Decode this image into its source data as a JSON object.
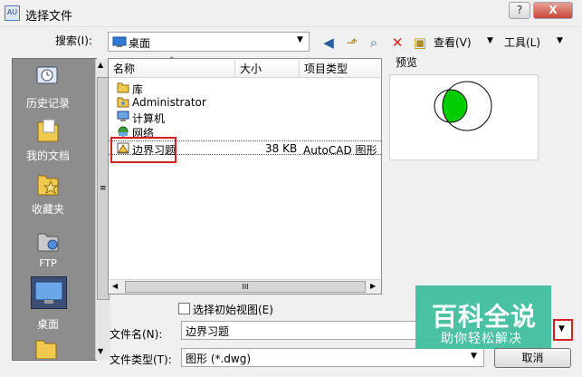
{
  "titlebar": {
    "title": "选择文件",
    "app_icon_text": "AU",
    "help_label": "?",
    "close_label": "X"
  },
  "toolbar": {
    "lookin_label": "搜索(I):",
    "location": "桌面",
    "views_label": "查看(V)",
    "tools_label": "工具(L)"
  },
  "places": [
    {
      "label": "历史记录"
    },
    {
      "label": "我的文档"
    },
    {
      "label": "收藏夹"
    },
    {
      "label": "FTP"
    },
    {
      "label": "桌面"
    }
  ],
  "file_list": {
    "columns": [
      "名称",
      "大小",
      "项目类型"
    ],
    "rows": [
      {
        "name": "库",
        "size": "",
        "type": ""
      },
      {
        "name": "Administrator",
        "size": "",
        "type": ""
      },
      {
        "name": "计算机",
        "size": "",
        "type": ""
      },
      {
        "name": "网络",
        "size": "",
        "type": ""
      },
      {
        "name": "边界习题",
        "size": "38 KB",
        "type": "AutoCAD 图形"
      }
    ],
    "selected_row": 4,
    "hscroll_label": "III"
  },
  "preview": {
    "label": "预览"
  },
  "options": {
    "initial_view_label": "选择初始视图(E)",
    "initial_view_checked": false
  },
  "filename": {
    "label": "文件名(N):",
    "value": "边界习题"
  },
  "filetype": {
    "label": "文件类型(T):",
    "value": "图形 (*.dwg)"
  },
  "buttons": {
    "cancel_label": "取消"
  },
  "watermark": {
    "line1": "百科全说",
    "line2": "助你轻松解决"
  },
  "colors": {
    "highlight": "#d42020",
    "watermark_bg": "#3dbd9c",
    "circle_fill": "#00cc00"
  }
}
